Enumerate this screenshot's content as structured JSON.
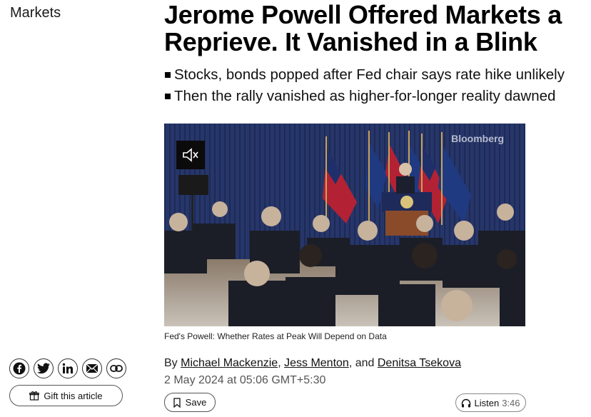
{
  "section": "Markets",
  "headline": "Jerome Powell Offered Markets a Reprieve. It Vanished in a Blink",
  "bullets": [
    "Stocks, bonds popped after Fed chair says rate hike unlikely",
    "Then the rally vanished as higher-for-longer reality dawned"
  ],
  "video": {
    "watermark": "Bloomberg",
    "mute_icon": "speaker-muted-icon",
    "caption": "Fed's Powell: Whether Rates at Peak Will Depend on Data"
  },
  "byline": {
    "prefix": "By",
    "authors": [
      "Michael Mackenzie",
      "Jess Menton",
      "Denitsa Tsekova"
    ],
    "sep1": ",",
    "sep2": ", and",
    "date": "2 May 2024 at 05:06 GMT+5:30"
  },
  "share": {
    "icons": [
      "facebook-icon",
      "twitter-icon",
      "linkedin-icon",
      "email-icon",
      "link-icon"
    ],
    "gift_label": "Gift this article"
  },
  "actions": {
    "save_label": "Save",
    "listen_label": "Listen",
    "listen_duration": "3:46"
  },
  "colors": {
    "backdrop": "#23305e",
    "text": "#000000"
  }
}
